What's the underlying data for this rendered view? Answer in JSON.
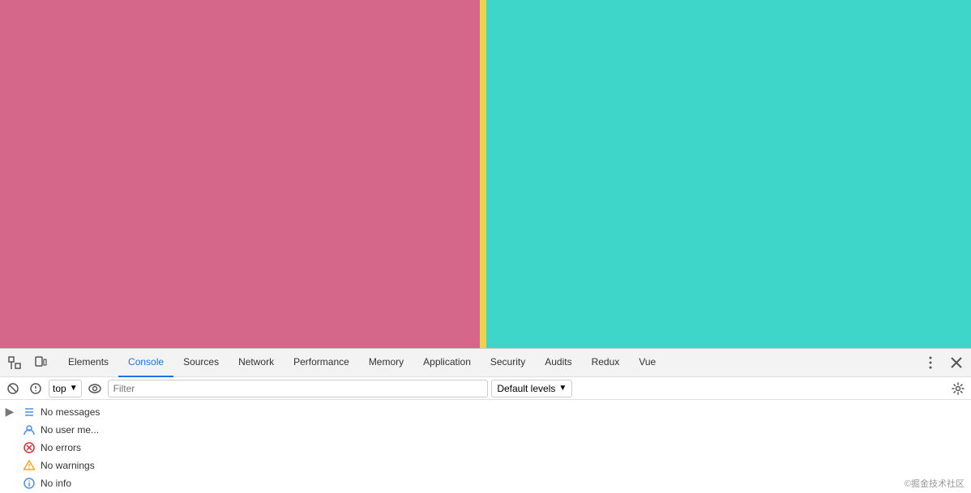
{
  "viewport": {
    "left_color": "#d4678a",
    "divider_color": "#e8d44d",
    "right_color": "#3dd6c8"
  },
  "devtools": {
    "tabs": [
      {
        "id": "elements",
        "label": "Elements",
        "active": false
      },
      {
        "id": "console",
        "label": "Console",
        "active": true
      },
      {
        "id": "sources",
        "label": "Sources",
        "active": false
      },
      {
        "id": "network",
        "label": "Network",
        "active": false
      },
      {
        "id": "performance",
        "label": "Performance",
        "active": false
      },
      {
        "id": "memory",
        "label": "Memory",
        "active": false
      },
      {
        "id": "application",
        "label": "Application",
        "active": false
      },
      {
        "id": "security",
        "label": "Security",
        "active": false
      },
      {
        "id": "audits",
        "label": "Audits",
        "active": false
      },
      {
        "id": "redux",
        "label": "Redux",
        "active": false
      },
      {
        "id": "vue",
        "label": "Vue",
        "active": false
      }
    ]
  },
  "console": {
    "context": "top",
    "context_arrow": "▼",
    "filter_placeholder": "Filter",
    "default_levels": "Default levels",
    "default_levels_arrow": "▼",
    "messages": [
      {
        "id": "no-messages",
        "icon": "list",
        "text": "No messages"
      },
      {
        "id": "no-user-messages",
        "icon": "user",
        "text": "No user me..."
      },
      {
        "id": "no-errors",
        "icon": "error",
        "text": "No errors"
      },
      {
        "id": "no-warnings",
        "icon": "warning",
        "text": "No warnings"
      },
      {
        "id": "no-info",
        "icon": "info",
        "text": "No info"
      }
    ]
  },
  "watermark": {
    "text": "©掘金技术社区"
  }
}
